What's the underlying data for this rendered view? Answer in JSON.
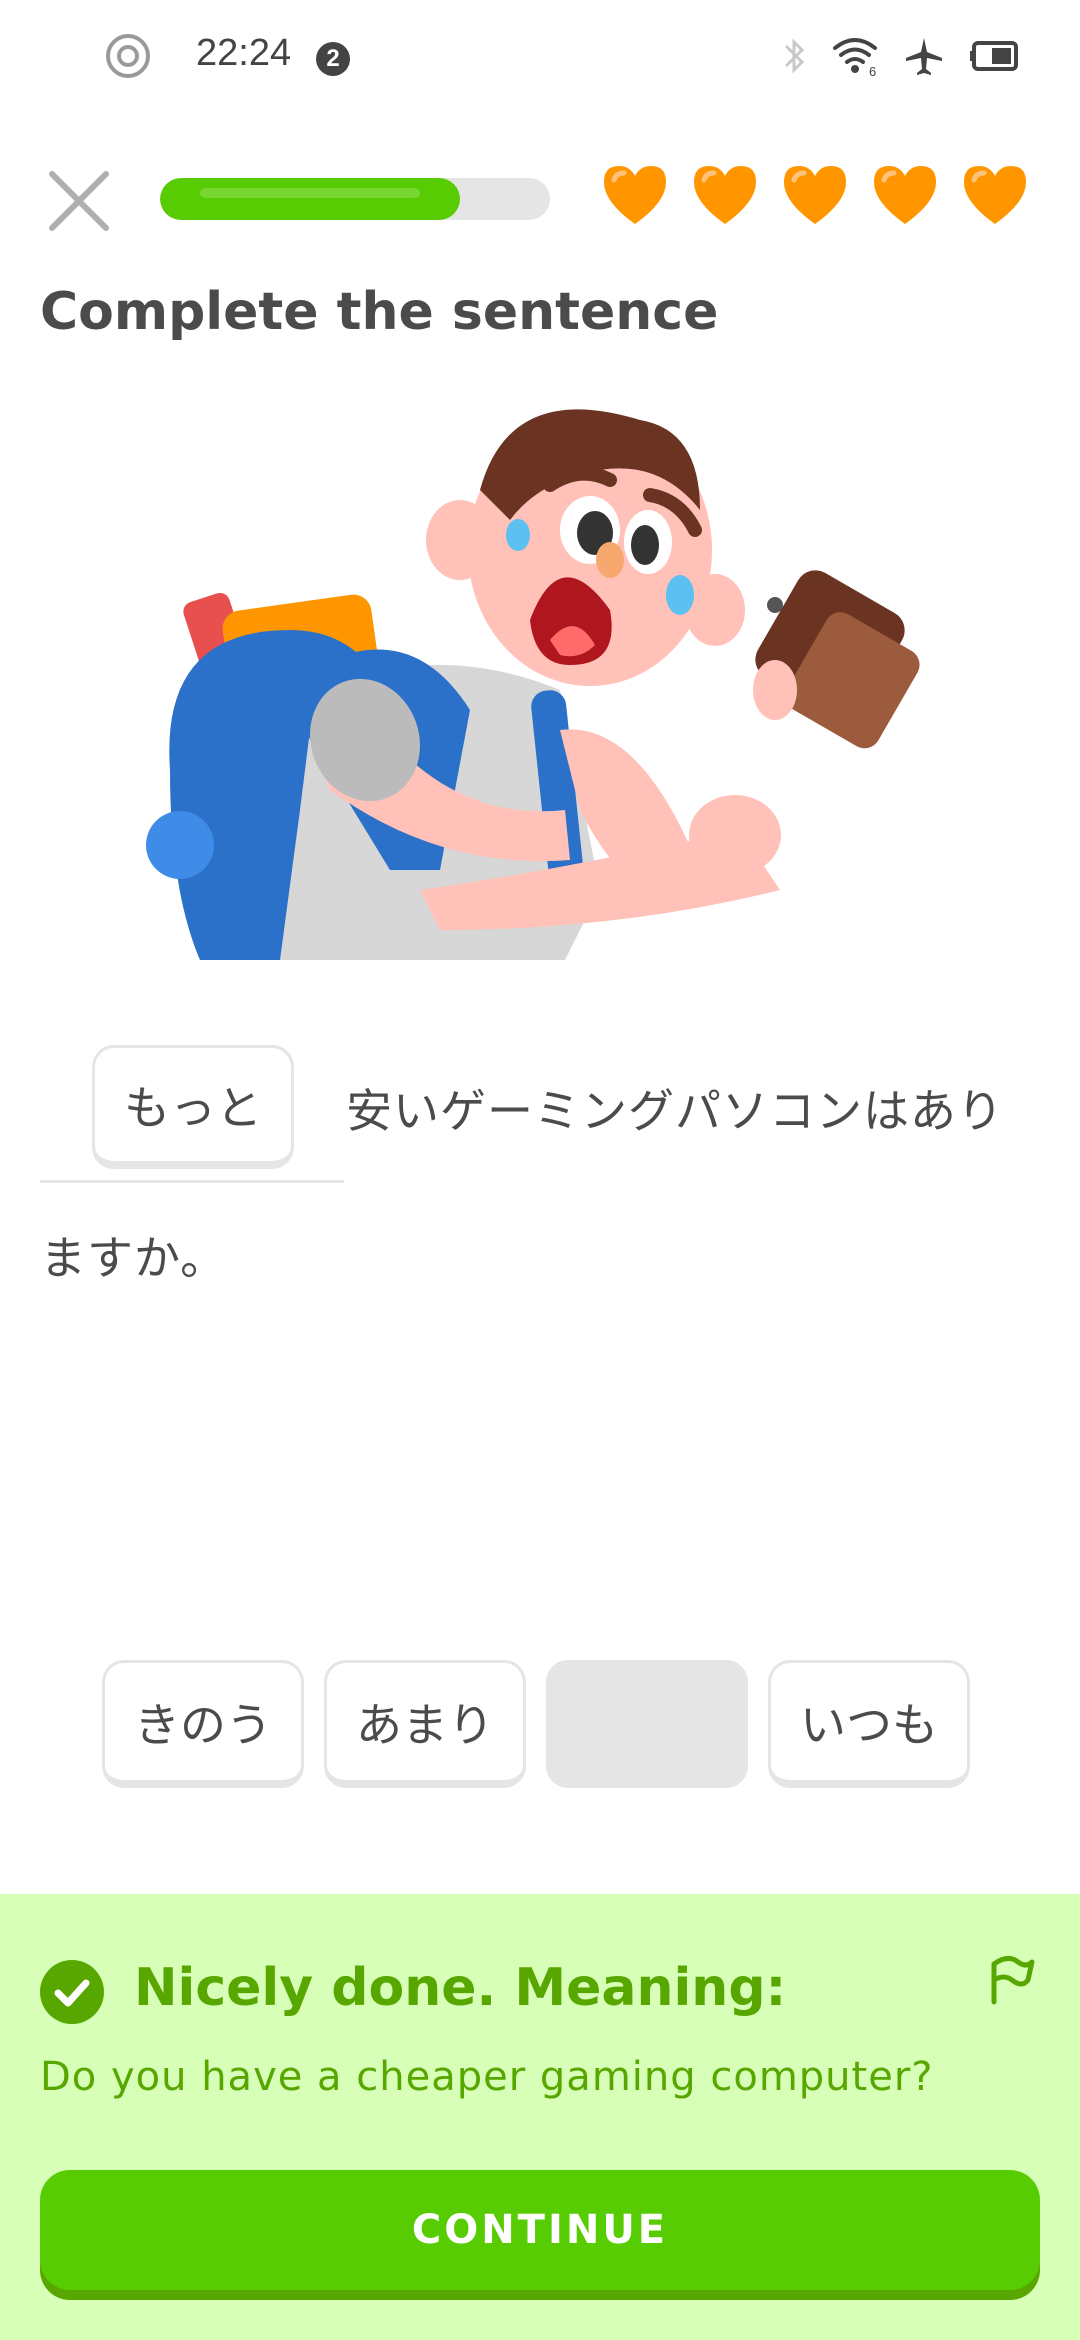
{
  "status_bar": {
    "time": "22:24",
    "notification_count": "2",
    "icons": [
      "circle-icon",
      "bluetooth-icon",
      "wifi-icon",
      "airplane-icon",
      "battery-icon"
    ],
    "wifi_label": "6"
  },
  "header": {
    "close_icon": "close-icon",
    "progress_fraction": 0.77,
    "hearts_count": 5
  },
  "exercise": {
    "title": "Complete the sentence",
    "selected_answer": "もっと",
    "sentence_rest_line1": "安いゲーミングパソコンはあり",
    "sentence_rest_line2": "ますか。"
  },
  "word_bank": {
    "words": [
      "きのう",
      "あまり",
      "",
      "いつも"
    ]
  },
  "feedback": {
    "heading": "Nicely done. Meaning:",
    "meaning": "Do you have a cheaper gaming computer?",
    "continue_label": "CONTINUE"
  },
  "colors": {
    "accent": "#58cc02",
    "accent_dark": "#58a700",
    "feedback_bg": "#d7ffb8",
    "heart": "#ff9600"
  }
}
